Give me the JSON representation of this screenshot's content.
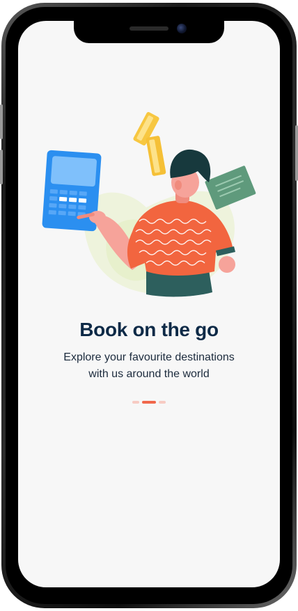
{
  "onboarding": {
    "title": "Book on the go",
    "subtitle_line1": "Explore your favourite destinations",
    "subtitle_line2": "with us around the world",
    "page_indicator": {
      "total_pages": 3,
      "active_page": 2
    }
  },
  "colors": {
    "title": "#0e2a47",
    "accent": "#f0674b",
    "accent_light": "#f7cbc3",
    "screen_background": "#f7f7f7"
  },
  "illustration": {
    "name": "person-with-calculator-and-coins"
  }
}
